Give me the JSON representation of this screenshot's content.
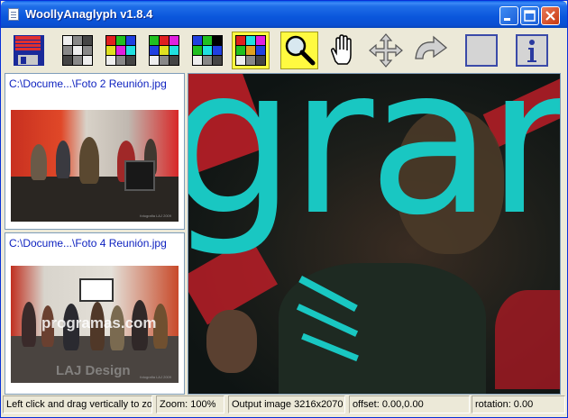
{
  "window": {
    "title": "WoollyAnaglyph v1.8.4"
  },
  "toolbar": {
    "tools": [
      {
        "name": "save-image",
        "icon": "floppy-disk-icon",
        "active": false
      },
      {
        "name": "mode-gray",
        "icon": "gray-grid-icon",
        "active": false
      },
      {
        "name": "mode-color-1",
        "icon": "color-grid-icon",
        "active": false
      },
      {
        "name": "mode-color-2",
        "icon": "color-grid-icon",
        "active": false
      },
      {
        "name": "mode-color-3",
        "icon": "green-grid-icon",
        "active": false
      },
      {
        "name": "mode-color-4",
        "icon": "color-grid-icon",
        "active": true
      },
      {
        "name": "zoom",
        "icon": "magnifier-icon",
        "active": true
      },
      {
        "name": "pan",
        "icon": "hand-icon",
        "active": false
      },
      {
        "name": "offset",
        "icon": "move-arrows-icon",
        "active": false
      },
      {
        "name": "rotate",
        "icon": "rotate-arrow-icon",
        "active": false
      },
      {
        "name": "frame",
        "icon": "frame-icon",
        "active": false
      },
      {
        "name": "about",
        "icon": "info-icon",
        "active": false
      }
    ]
  },
  "left_panel": {
    "thumbnails": [
      {
        "label": "C:\\Docume...\\Foto 2 Reunión.jpg",
        "caption": "fotografia LAJ 2009"
      },
      {
        "label": "C:\\Docume...\\Foto 4 Reunión.jpg",
        "caption": "fotografia LAJ 2009",
        "watermark_1": "programas.com",
        "watermark_2": "LAJ Design"
      }
    ]
  },
  "viewer": {
    "visible_text": "gran"
  },
  "statusbar": {
    "hint": "Left click and drag vertically to zoom",
    "zoom": "Zoom: 100%",
    "output": "Output image 3216x2070",
    "offset": "offset: 0.00,0.00",
    "rotation": "rotation: 0.00"
  },
  "colors": {
    "title_blue": "#0a56dc",
    "cyan": "#19c7c2",
    "red": "#d4202a",
    "highlight": "#fffa40"
  }
}
